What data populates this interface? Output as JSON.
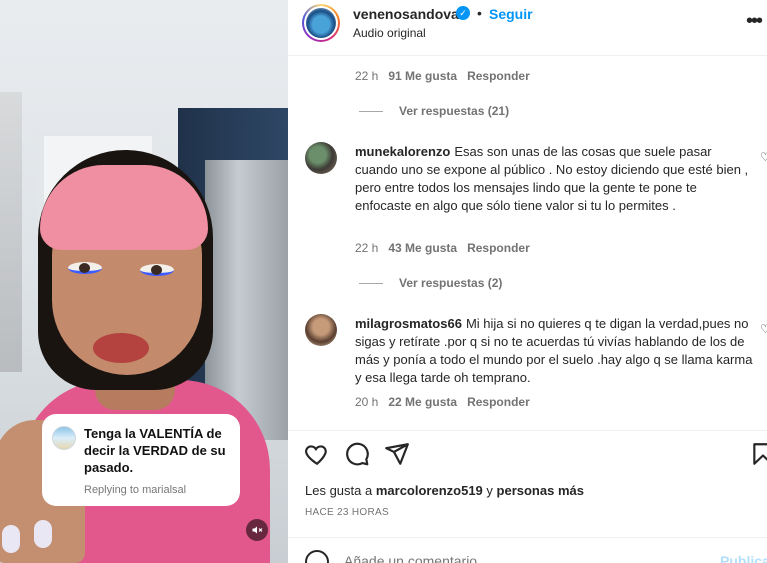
{
  "video": {
    "reply_card": {
      "text": "Tenga la VALENTÍA de decir la VERDAD de su pasado.",
      "replying_to": "Replying to marialsal"
    },
    "mute_icon": "speaker-muted-icon"
  },
  "header": {
    "username": "venenosandoval",
    "follow_label": "Seguir",
    "dot": "•",
    "subtitle": "Audio original",
    "more_icon": "ellipsis-icon"
  },
  "comments": {
    "top_meta": {
      "time": "22 h",
      "likes": "91 Me gusta",
      "reply": "Responder"
    },
    "top_view_replies": "Ver respuestas (21)",
    "items": [
      {
        "username": "munekalorenzo",
        "text": "Esas son unas de las cosas que suele pasar cuando uno se expone al público . No estoy diciendo que esté bien , pero entre todos los mensajes lindo que la gente te pone te enfocaste en algo que sólo tiene valor si tu lo permites .",
        "time": "22 h",
        "likes": "43 Me gusta",
        "reply": "Responder",
        "view_replies": "Ver respuestas (2)"
      },
      {
        "username": "milagrosmatos66",
        "text": "Mi hija si no quieres q te digan la verdad,pues no sigas y retírate .por q si no te acuerdas tú vivías hablando de los de más y ponía a todo el mundo por el suelo .hay algo q se llama karma y esa llega tarde oh temprano.",
        "time": "20 h",
        "likes": "22 Me gusta",
        "reply": "Responder"
      }
    ]
  },
  "actions": {
    "likes_prefix": "Les gusta a",
    "likes_user": "marcolorenzo519",
    "likes_and": "y",
    "likes_others": "personas más",
    "timestamp": "HACE 23 HORAS"
  },
  "comment_box": {
    "placeholder": "Añade un comentario...",
    "post_label": "Publicar"
  },
  "colors": {
    "accent": "#0095f6",
    "post_disabled": "#b2dffc",
    "muted_text": "#737373"
  }
}
